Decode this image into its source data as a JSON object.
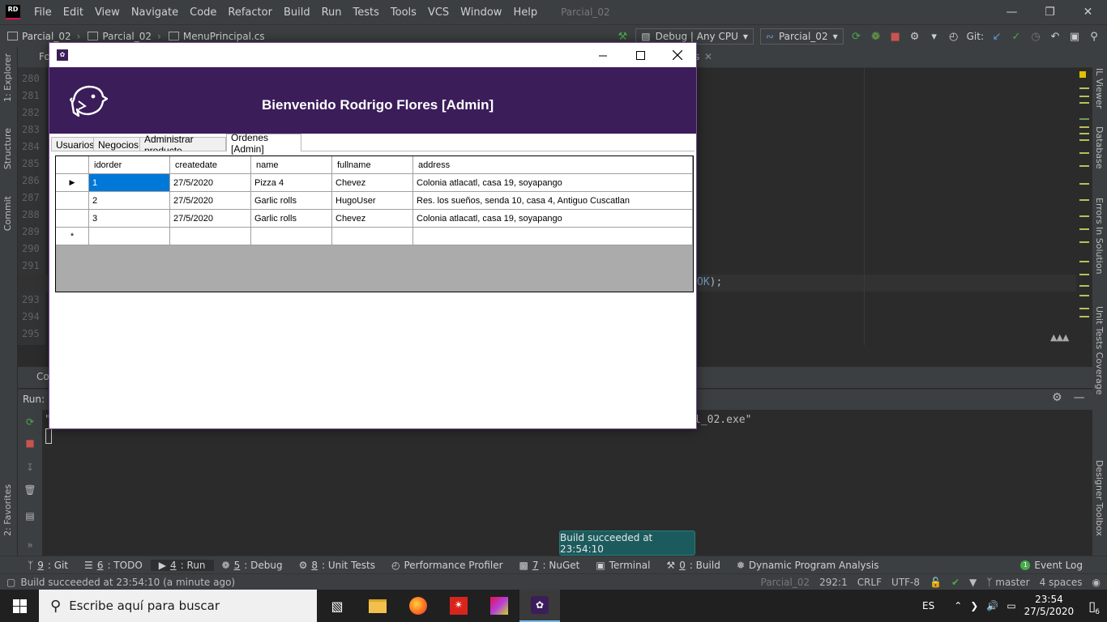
{
  "ide": {
    "logo": "RD",
    "menu": [
      "File",
      "Edit",
      "View",
      "Navigate",
      "Code",
      "Refactor",
      "Build",
      "Run",
      "Tests",
      "Tools",
      "VCS",
      "Window",
      "Help"
    ],
    "project_title": "Parcial_02",
    "breadcrumbs": [
      "Parcial_02",
      "Parcial_02",
      "MenuPrincipal.cs"
    ],
    "config_combo": "Debug | Any CPU",
    "project_combo": "Parcial_02",
    "git_label": "Git:",
    "editor_tab_fragment": "Fo",
    "editor_tab_fragment_2": "s",
    "line_numbers": [
      "280",
      "281",
      "282",
      "283",
      "284",
      "285",
      "286",
      "287",
      "288",
      "289",
      "290",
      "291",
      "292",
      "293",
      "294",
      "295"
    ],
    "code_fragment_kw": "OK",
    "code_fragment_rest": ");",
    "left_panels": [
      "1: Explorer",
      "Structure",
      "Commit",
      "2: Favorites"
    ],
    "right_panels": [
      "IL Viewer",
      "Database",
      "Errors In Solution",
      "Unit Tests Coverage",
      "Designer Toolbox"
    ],
    "console_tab_fragment": "Co",
    "run_label": "Run:",
    "console_quote": "\"",
    "console_text": "l_02.exe\"",
    "tool_windows": [
      {
        "key": "9",
        "label": ": Git"
      },
      {
        "key": "6",
        "label": ": TODO"
      },
      {
        "key": "4",
        "label": ": Run"
      },
      {
        "key": "5",
        "label": ": Debug"
      },
      {
        "key": "8",
        "label": ": Unit Tests"
      },
      {
        "key": "",
        "label": "Performance Profiler"
      },
      {
        "key": "7",
        "label": ": NuGet"
      },
      {
        "key": "",
        "label": "Terminal"
      },
      {
        "key": "0",
        "label": ": Build"
      },
      {
        "key": "",
        "label": "Dynamic Program Analysis"
      }
    ],
    "event_log": "Event Log",
    "event_log_count": "1",
    "status_message": "Build succeeded at 23:54:10 (a minute ago)",
    "status_project": "Parcial_02",
    "status_position": "292:1",
    "status_line_sep": "CRLF",
    "status_encoding": "UTF-8",
    "status_branch": "master",
    "status_indent": "4 spaces",
    "build_popup": "Build succeeded at 23:54:10"
  },
  "taskbar": {
    "search_placeholder": "Escribe aquí para buscar",
    "language": "ES",
    "time": "23:54",
    "date": "27/5/2020",
    "notification_count": "6"
  },
  "winform": {
    "welcome": "Bienvenido Rodrigo Flores [Admin]",
    "tabs": [
      "Usuarios",
      "Negocios",
      "Administrar producto",
      "Ordenes [Admin]"
    ],
    "selected_tab": "Ordenes [Admin]",
    "grid": {
      "columns": [
        "idorder",
        "createdate",
        "name",
        "fullname",
        "address"
      ],
      "rows": [
        [
          "1",
          "27/5/2020",
          "Pizza 4",
          "Chevez",
          "Colonia atlacatl, casa 19, soyapango"
        ],
        [
          "2",
          "27/5/2020",
          "Garlic rolls",
          "HugoUser",
          "Res. los sueños, senda 10, casa 4, Antiguo Cuscatlan"
        ],
        [
          "3",
          "27/5/2020",
          "Garlic rolls",
          "Chevez",
          "Colonia atlacatl, casa 19, soyapango"
        ]
      ],
      "new_row_marker": "*",
      "current_row_marker": "▶"
    }
  },
  "colors": {
    "header_purple": "#3b1d5a",
    "selection_blue": "#0078d7",
    "grid_background": "#ababab",
    "popup_teal": "#1c5b5d",
    "ide_dark": "#2b2b2b"
  }
}
